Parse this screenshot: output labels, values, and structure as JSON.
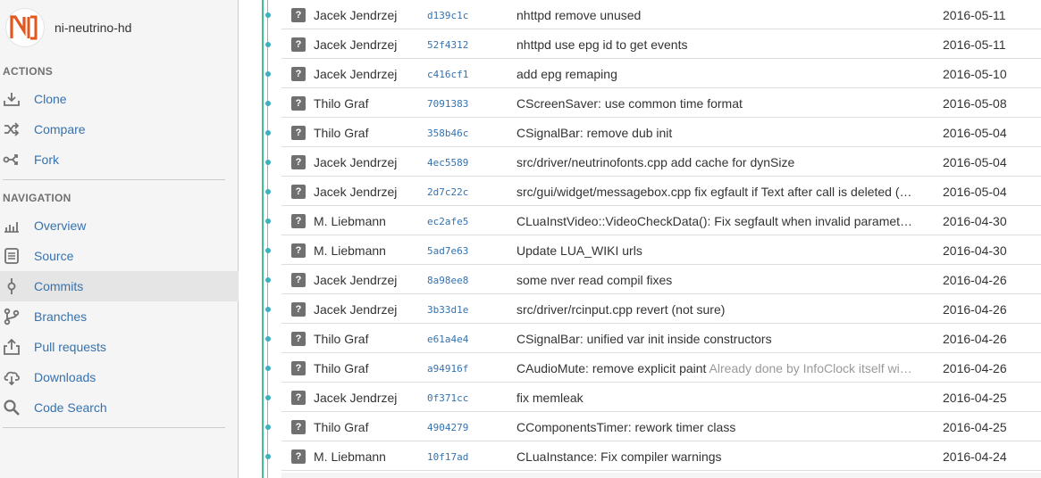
{
  "sidebar": {
    "repo_name": "ni-neutrino-hd",
    "logo_text": "NI",
    "actions_heading": "ACTIONS",
    "actions": [
      {
        "label": "Clone",
        "icon": "download-icon"
      },
      {
        "label": "Compare",
        "icon": "compare-icon"
      },
      {
        "label": "Fork",
        "icon": "fork-icon"
      }
    ],
    "navigation_heading": "NAVIGATION",
    "navigation": [
      {
        "label": "Overview",
        "icon": "overview-icon"
      },
      {
        "label": "Source",
        "icon": "source-icon"
      },
      {
        "label": "Commits",
        "icon": "commits-icon",
        "active": true
      },
      {
        "label": "Branches",
        "icon": "branches-icon"
      },
      {
        "label": "Pull requests",
        "icon": "pull-request-icon"
      },
      {
        "label": "Downloads",
        "icon": "cloud-download-icon"
      },
      {
        "label": "Code Search",
        "icon": "search-icon"
      }
    ]
  },
  "colors": {
    "link": "#3572b0",
    "graph_line": "#3ebf91",
    "logo_orange": "#e2571e"
  },
  "commits": [
    {
      "author": "Jacek Jendrzej",
      "hash": "d139c1c",
      "message": "nhttpd remove unused",
      "extra": "",
      "date": "2016-05-11"
    },
    {
      "author": "Jacek Jendrzej",
      "hash": "52f4312",
      "message": "nhttpd use epg id to get events",
      "extra": "",
      "date": "2016-05-11"
    },
    {
      "author": "Jacek Jendrzej",
      "hash": "c416cf1",
      "message": "add epg remaping",
      "extra": "",
      "date": "2016-05-10"
    },
    {
      "author": "Thilo Graf",
      "hash": "7091383",
      "message": "CScreenSaver: use common time format",
      "extra": "",
      "date": "2016-05-08"
    },
    {
      "author": "Thilo Graf",
      "hash": "358b46c",
      "message": "CSignalBar: remove dub init",
      "extra": "",
      "date": "2016-05-04"
    },
    {
      "author": "Jacek Jendrzej",
      "hash": "4ec5589",
      "message": "src/driver/neutrinofonts.cpp add cache for dynSize",
      "extra": "",
      "date": "2016-05-04"
    },
    {
      "author": "Jacek Jendrzej",
      "hash": "2d7c22c",
      "message": "src/gui/widget/messagebox.cpp fix egfault if Text after call is deleted (…",
      "extra": "",
      "date": "2016-05-04"
    },
    {
      "author": "M. Liebmann",
      "hash": "ec2afe5",
      "message": "CLuaInstVideo::VideoCheckData(): Fix segfault when invalid paramet…",
      "extra": "",
      "date": "2016-04-30"
    },
    {
      "author": "M. Liebmann",
      "hash": "5ad7e63",
      "message": "Update LUA_WIKI urls",
      "extra": "",
      "date": "2016-04-30"
    },
    {
      "author": "Jacek Jendrzej",
      "hash": "8a98ee8",
      "message": "some nver read compil fixes",
      "extra": "",
      "date": "2016-04-26"
    },
    {
      "author": "Jacek Jendrzej",
      "hash": "3b33d1e",
      "message": "src/driver/rcinput.cpp revert (not sure)",
      "extra": "",
      "date": "2016-04-26"
    },
    {
      "author": "Thilo Graf",
      "hash": "e61a4e4",
      "message": "CSignalBar: unified var init inside constructors",
      "extra": "",
      "date": "2016-04-26"
    },
    {
      "author": "Thilo Graf",
      "hash": "a94916f",
      "message": "CAudioMute: remove explicit paint",
      "extra": " Already done by InfoClock itself wi…",
      "date": "2016-04-26"
    },
    {
      "author": "Jacek Jendrzej",
      "hash": "0f371cc",
      "message": "fix memleak",
      "extra": "",
      "date": "2016-04-25"
    },
    {
      "author": "Thilo Graf",
      "hash": "4904279",
      "message": "CComponentsTimer: rework timer class",
      "extra": "",
      "date": "2016-04-25"
    },
    {
      "author": "M. Liebmann",
      "hash": "10f17ad",
      "message": "CLuaInstance: Fix compiler warnings",
      "extra": "",
      "date": "2016-04-24"
    }
  ]
}
